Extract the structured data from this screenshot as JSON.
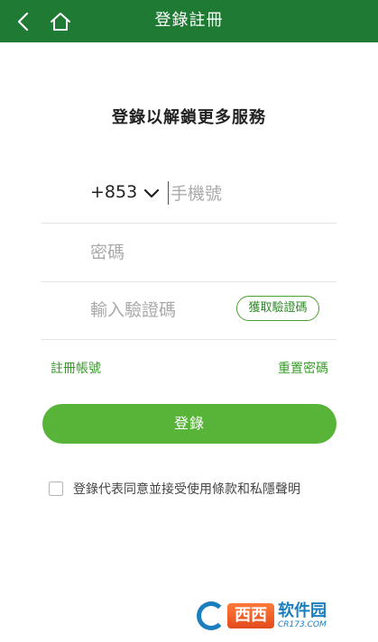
{
  "header": {
    "title": "登錄註冊",
    "back_icon": "back-arrow-icon",
    "home_icon": "home-icon",
    "background": "#1f7a34"
  },
  "main": {
    "heading": "登錄以解鎖更多服務",
    "phone": {
      "country_code": "+853",
      "placeholder": "手機號",
      "value": ""
    },
    "password": {
      "placeholder": "密碼",
      "value": ""
    },
    "verification": {
      "placeholder": "輸入驗證碼",
      "value": "",
      "get_code_label": "獲取驗證碼"
    },
    "links": {
      "register": "註冊帳號",
      "reset_password": "重置密碼"
    },
    "login_button": "登錄",
    "agreement": {
      "checked": false,
      "text": "登錄代表同意並接受使用條款和私隱聲明"
    }
  },
  "watermark": {
    "badge": "西西",
    "text": "软件园",
    "domain": "CR173.COM"
  },
  "colors": {
    "accent": "#57b439",
    "link": "#3a9a2c",
    "header": "#1f7a34"
  }
}
